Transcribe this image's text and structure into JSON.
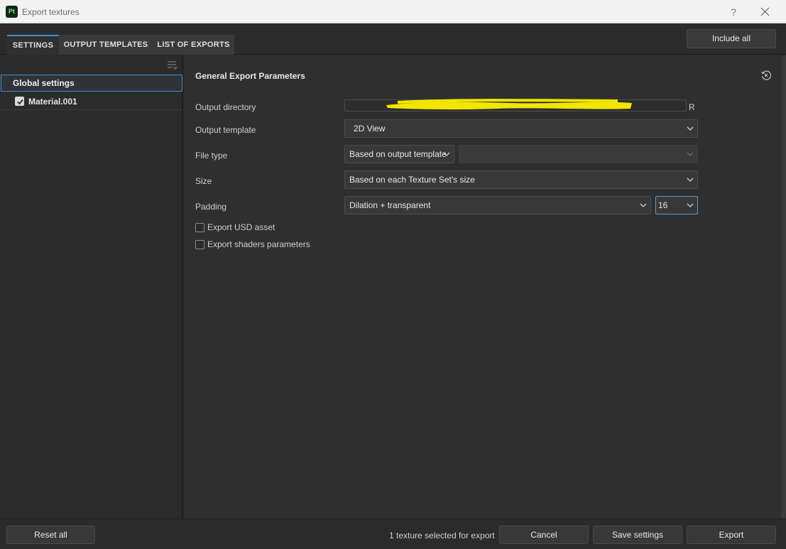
{
  "window": {
    "app_icon_text": "Pt",
    "title": "Export textures",
    "help_label": "?"
  },
  "tabs": [
    {
      "label": "SETTINGS",
      "active": true
    },
    {
      "label": "OUTPUT TEMPLATES",
      "active": false
    },
    {
      "label": "LIST OF EXPORTS",
      "active": false
    }
  ],
  "toolbar": {
    "include_all_label": "Include all"
  },
  "sidebar": {
    "global_label": "Global settings",
    "material_label": "Material.001",
    "material_checked": true
  },
  "main": {
    "section_title": "General Export Parameters",
    "output_directory": {
      "label": "Output directory",
      "value": "",
      "suffix": "R"
    },
    "output_template": {
      "label": "Output template",
      "value": "2D View"
    },
    "file_type": {
      "label": "File type",
      "value": "Based on output template",
      "secondary_value": ""
    },
    "size": {
      "label": "Size",
      "value": "Based on each Texture Set's size"
    },
    "padding": {
      "label": "Padding",
      "value": "Dilation + transparent",
      "amount": "16"
    },
    "options": [
      {
        "label": "Export USD asset",
        "checked": false
      },
      {
        "label": "Export shaders parameters",
        "checked": false
      }
    ]
  },
  "footer": {
    "reset_label": "Reset all",
    "status": "1 texture selected for export",
    "cancel_label": "Cancel",
    "save_label": "Save settings",
    "export_label": "Export"
  },
  "colors": {
    "accent": "#3c8fd0",
    "background": "#2b2b2b",
    "redaction": "#f2e500"
  }
}
